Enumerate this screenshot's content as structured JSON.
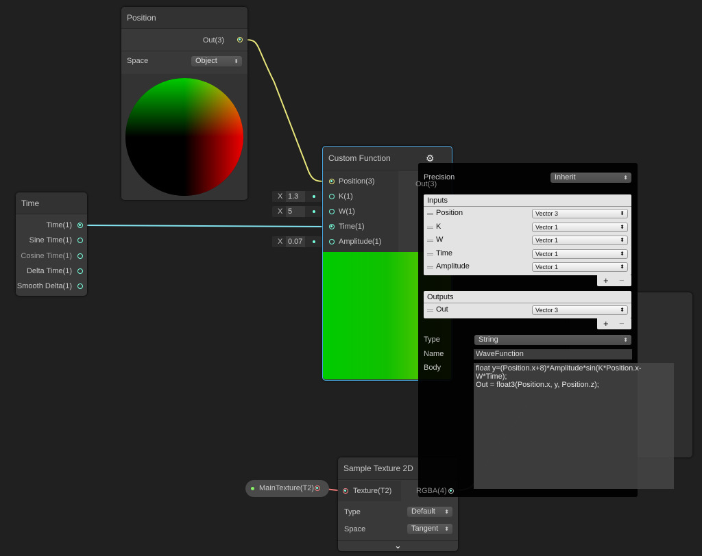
{
  "position_node": {
    "title": "Position",
    "out_port": "Out(3)",
    "space_label": "Space",
    "space_value": "Object"
  },
  "time_node": {
    "title": "Time",
    "outputs": [
      "Time(1)",
      "Sine Time(1)",
      "Cosine Time(1)",
      "Delta Time(1)",
      "Smooth Delta(1)"
    ]
  },
  "custom_function_node": {
    "title": "Custom Function",
    "inputs": [
      "Position(3)",
      "K(1)",
      "W(1)",
      "Time(1)",
      "Amplitude(1)"
    ],
    "output": "Out(3)",
    "inline_values": [
      {
        "axis": "X",
        "value": "1.3"
      },
      {
        "axis": "X",
        "value": "5"
      },
      {
        "axis": "X",
        "value": "0.07"
      }
    ]
  },
  "settings_popup": {
    "precision_label": "Precision",
    "precision_value": "Inherit",
    "inputs_title": "Inputs",
    "inputs": [
      {
        "name": "Position",
        "type": "Vector 3"
      },
      {
        "name": "K",
        "type": "Vector 1"
      },
      {
        "name": "W",
        "type": "Vector 1"
      },
      {
        "name": "Time",
        "type": "Vector 1"
      },
      {
        "name": "Amplitude",
        "type": "Vector 1"
      }
    ],
    "outputs_title": "Outputs",
    "outputs": [
      {
        "name": "Out",
        "type": "Vector 3"
      }
    ],
    "plus": "+",
    "minus": "−",
    "type_label": "Type",
    "type_value": "String",
    "name_label": "Name",
    "name_value": "WaveFunction",
    "body_label": "Body",
    "body_value": "float y=(Position.x+8)*Amplitude*sin(K*Position.x-W*Time);\nOut = float3(Position.x, y, Position.z);"
  },
  "sample_texture_node": {
    "title": "Sample Texture 2D",
    "input": "Texture(T2)",
    "output": "RGBA(4)",
    "type_label": "Type",
    "type_value": "Default",
    "space_label": "Space",
    "space_value": "Tangent",
    "expand": "⌄"
  },
  "property_node": {
    "label": "MainTexture(T2)"
  },
  "colors": {
    "vector3_wire": "#e8e67a",
    "vector1_wire": "#84e4f0",
    "texture_wire": "#f07b7b",
    "selection": "#4aa8e0"
  }
}
